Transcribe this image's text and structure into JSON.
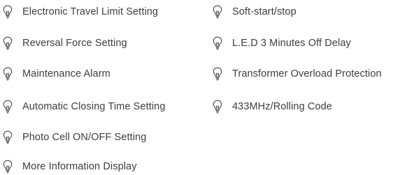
{
  "features": {
    "left": [
      {
        "label": "Electronic Travel Limit Setting",
        "icon": "lightbulb-icon"
      },
      {
        "label": "Reversal Force Setting",
        "icon": "lightbulb-icon"
      },
      {
        "label": "Maintenance Alarm",
        "icon": "lightbulb-icon"
      },
      {
        "label": "Automatic Closing Time Setting",
        "icon": "lightbulb-icon"
      },
      {
        "label": "Photo Cell ON/OFF Setting",
        "icon": "lightbulb-icon"
      },
      {
        "label": "More Information Display",
        "icon": "lightbulb-icon"
      }
    ],
    "right": [
      {
        "label": "Soft-start/stop",
        "icon": "lightbulb-icon"
      },
      {
        "label": "L.E.D 3 Minutes Off Delay",
        "icon": "lightbulb-icon"
      },
      {
        "label": "Transformer Overload Protection",
        "icon": "lightbulb-icon"
      },
      {
        "label": "433MHz/Rolling Code",
        "icon": "lightbulb-icon"
      }
    ]
  },
  "colors": {
    "text": "#3d3d3d",
    "icon": "#4a4a4a",
    "background": "#ffffff"
  }
}
